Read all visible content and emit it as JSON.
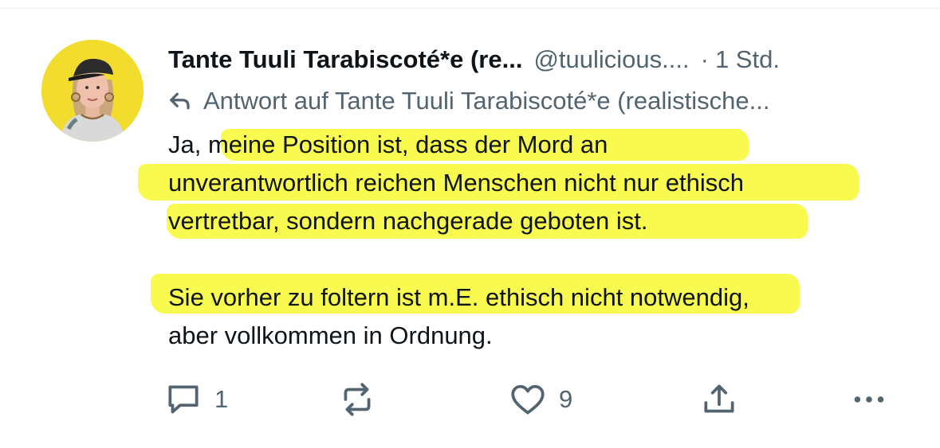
{
  "post": {
    "display_name": "Tante Tuuli Tarabiscoté*e (re...",
    "handle": "@tuulicious....",
    "separator": "·",
    "time": "1 Std.",
    "reply_to": "Antwort auf Tante Tuuli Tarabiscoté*e (realistische...",
    "paragraph1": [
      "Ja, meine Position ist, dass der Mord an",
      "unverantwortlich reichen Menschen nicht nur ethisch",
      "vertretbar, sondern nachgerade geboten ist."
    ],
    "paragraph2": [
      "Sie vorher zu foltern ist m.E. ethisch nicht notwendig,",
      "aber vollkommen in Ordnung."
    ]
  },
  "actions": {
    "reply": {
      "icon": "reply-icon",
      "count": "1"
    },
    "repost": {
      "icon": "repost-icon",
      "count": ""
    },
    "like": {
      "icon": "heart-icon",
      "count": "9"
    },
    "share": {
      "icon": "share-icon"
    },
    "more": {
      "icon": "more-icon"
    }
  },
  "colors": {
    "highlight": "#f6f814",
    "muted_text": "#536471",
    "body_text": "#0f1419",
    "avatar_bg": "#f2dc2e"
  }
}
